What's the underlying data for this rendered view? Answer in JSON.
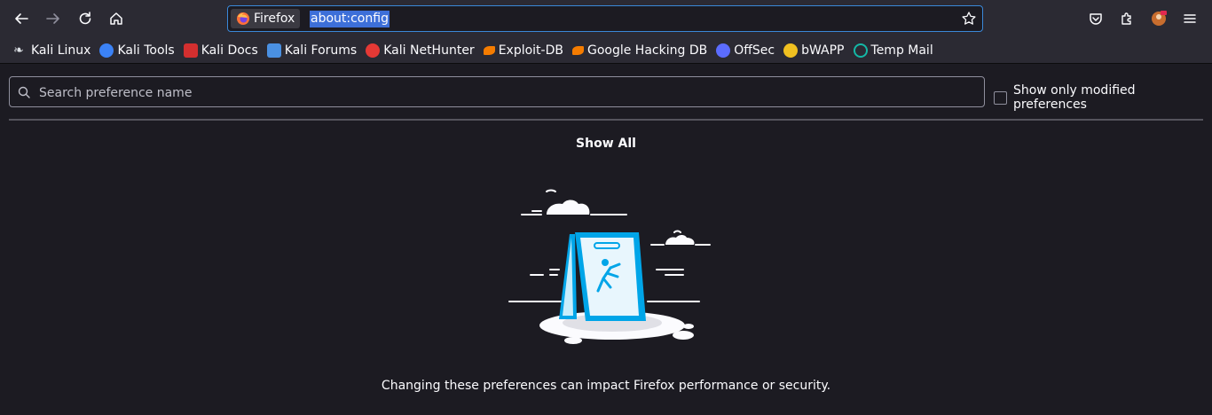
{
  "toolbar": {
    "back_icon": "arrow-left-icon",
    "forward_icon": "arrow-right-icon",
    "reload_icon": "reload-icon",
    "home_icon": "home-icon"
  },
  "urlbar": {
    "identity_label": "Firefox",
    "url": "about:config"
  },
  "bookmarks": [
    {
      "label": "Kali Linux",
      "color": "#dfe3e8"
    },
    {
      "label": "Kali Tools",
      "color": "#3b82f6"
    },
    {
      "label": "Kali Docs",
      "color": "#d32f2f"
    },
    {
      "label": "Kali Forums",
      "color": "#4a90e2"
    },
    {
      "label": "Kali NetHunter",
      "color": "#e53935"
    },
    {
      "label": "Exploit-DB",
      "color": "#f57c00"
    },
    {
      "label": "Google Hacking DB",
      "color": "#f57c00"
    },
    {
      "label": "OffSec",
      "color": "#5b6cff"
    },
    {
      "label": "bWAPP",
      "color": "#f0c020"
    },
    {
      "label": "Temp Mail",
      "color": "#14b8a6"
    }
  ],
  "search": {
    "placeholder": "Search preference name"
  },
  "modified_toggle": {
    "label": "Show only modified preferences"
  },
  "show_all_label": "Show All",
  "warning": "Changing these preferences can impact Firefox performance or security.",
  "colors": {
    "accent": "#00a5e8",
    "url_selection": "#3d6fd8",
    "background": "#1c1b22"
  }
}
